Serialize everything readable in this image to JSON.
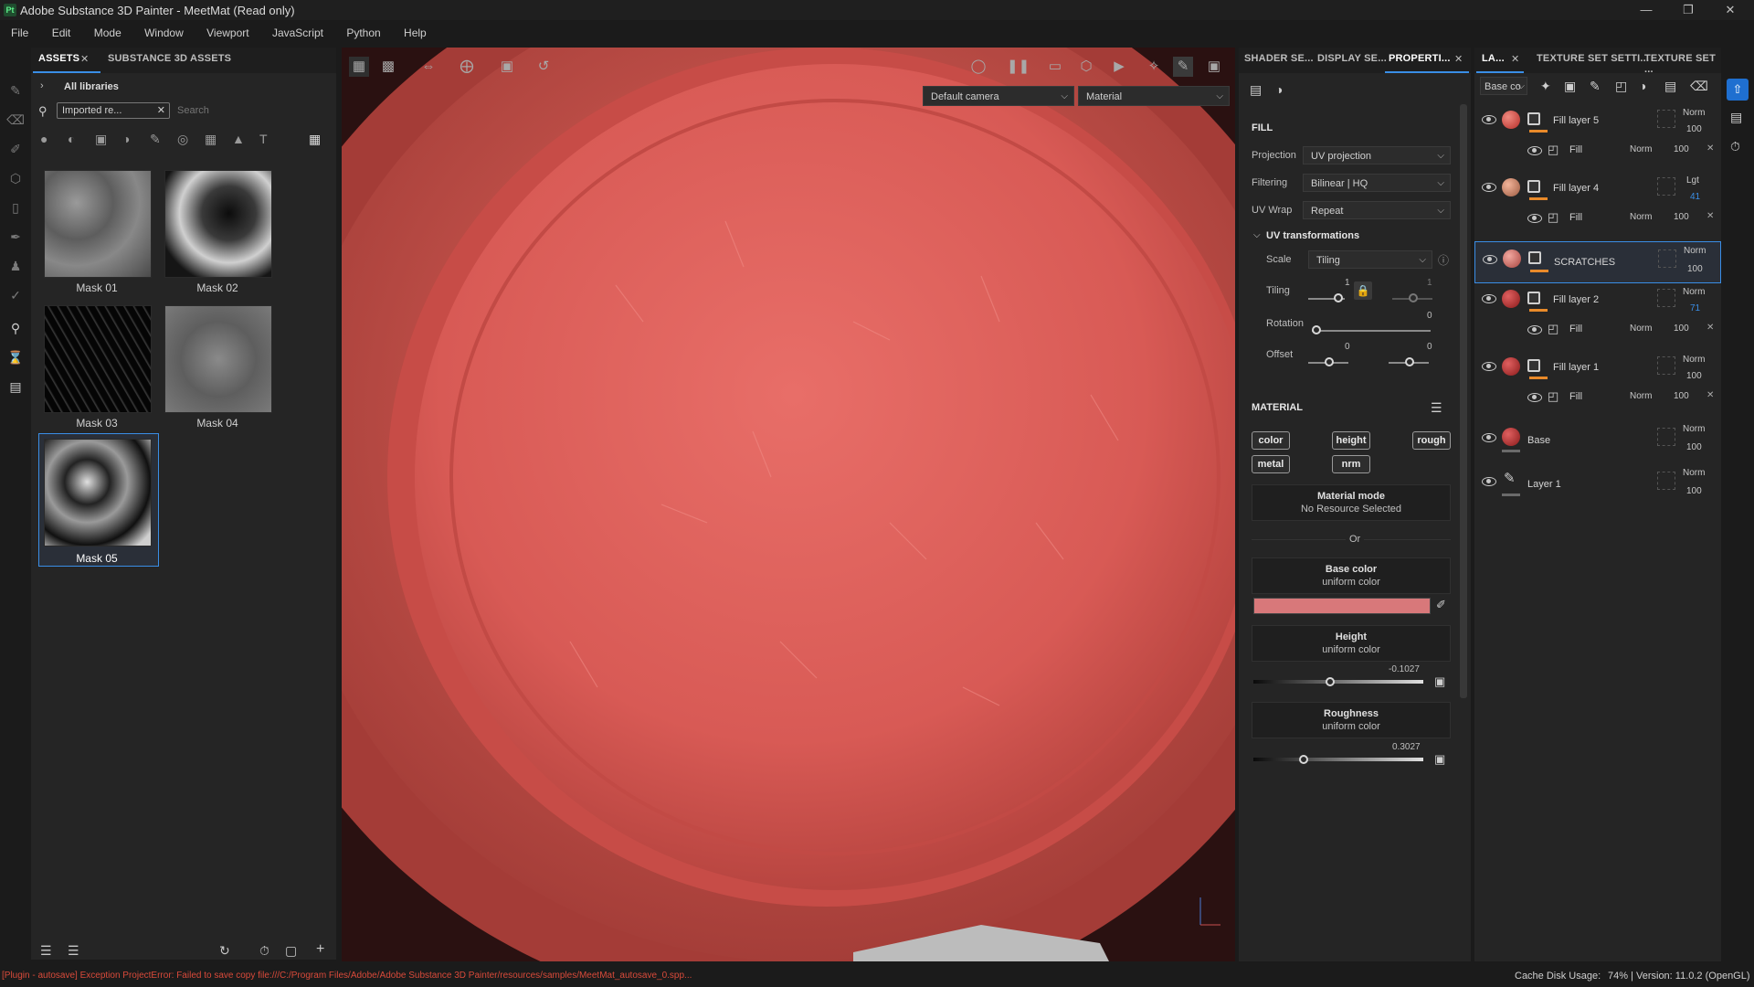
{
  "window": {
    "title": "Adobe Substance 3D Painter - MeetMat (Read only)",
    "logo": "Pt",
    "controls": [
      "minimize-icon",
      "maximize-icon",
      "close-icon"
    ]
  },
  "menu": [
    "File",
    "Edit",
    "Mode",
    "Window",
    "Viewport",
    "JavaScript",
    "Python",
    "Help"
  ],
  "assets": {
    "tabs": [
      "ASSETS",
      "SUBSTANCE 3D ASSETS"
    ],
    "breadcrumb": "All libraries",
    "filter_chip": "Imported re...",
    "search_placeholder": "Search",
    "items": [
      {
        "label": "Mask 01"
      },
      {
        "label": "Mask 02"
      },
      {
        "label": "Mask 03"
      },
      {
        "label": "Mask 04"
      },
      {
        "label": "Mask 05"
      }
    ],
    "selected": "Mask 05"
  },
  "viewport": {
    "camera": "Default camera",
    "mode": "Material"
  },
  "properties": {
    "tabs": [
      "SHADER SE...",
      "DISPLAY SE...",
      "PROPERTI..."
    ],
    "fill_title": "FILL",
    "projection_label": "Projection",
    "projection_value": "UV projection",
    "filtering_label": "Filtering",
    "filtering_value": "Bilinear | HQ",
    "uvwrap_label": "UV Wrap",
    "uvwrap_value": "Repeat",
    "uvtrans_title": "UV transformations",
    "scale_label": "Scale",
    "scale_value": "Tiling",
    "tiling_label": "Tiling",
    "tiling_val1": "1",
    "tiling_val2": "1",
    "rotation_label": "Rotation",
    "rotation_val": "0",
    "offset_label": "Offset",
    "offset_val1": "0",
    "offset_val2": "0",
    "material_title": "MATERIAL",
    "chips": [
      "color",
      "height",
      "rough",
      "metal",
      "nrm"
    ],
    "material_mode_title": "Material mode",
    "material_mode_sub": "No Resource Selected",
    "or_text": "Or",
    "base_color_title": "Base color",
    "base_color_sub": "uniform color",
    "base_color_hex": "#d8787a",
    "height_title": "Height",
    "height_sub": "uniform color",
    "height_value": "-0.1027",
    "roughness_title": "Roughness",
    "roughness_sub": "uniform color",
    "roughness_value": "0.3027"
  },
  "layers": {
    "tabs": [
      "LA...",
      "TEXTURE SET SETTI...",
      "TEXTURE SET ..."
    ],
    "channel": "Base co",
    "rows": [
      {
        "name": "Fill layer 5",
        "blend": "Norm",
        "opacity": "100",
        "sub": "Fill",
        "sub_blend": "Norm",
        "sub_opacity": "100"
      },
      {
        "name": "Fill layer 4",
        "blend": "Lgt",
        "opacity": "41",
        "sub": "Fill",
        "sub_blend": "Norm",
        "sub_opacity": "100"
      },
      {
        "name": "SCRATCHES",
        "blend": "Norm",
        "opacity": "100"
      },
      {
        "name": "Fill layer 2",
        "blend": "Norm",
        "opacity": "71",
        "sub": "Fill",
        "sub_blend": "Norm",
        "sub_opacity": "100"
      },
      {
        "name": "Fill layer 1",
        "blend": "Norm",
        "opacity": "100",
        "sub": "Fill",
        "sub_blend": "Norm",
        "sub_opacity": "100"
      },
      {
        "name": "Base",
        "blend": "Norm",
        "opacity": "100"
      },
      {
        "name": "Layer 1",
        "blend": "Norm",
        "opacity": "100"
      }
    ]
  },
  "status": {
    "error": "[Plugin - autosave] Exception ProjectError: Failed to save copy file:///C:/Program Files/Adobe/Adobe Substance 3D Painter/resources/samples/MeetMat_autosave_0.spp...",
    "cache_label": "Cache Disk Usage:",
    "cache_value": "74% | Version: 11.0.2 (OpenGL)"
  }
}
